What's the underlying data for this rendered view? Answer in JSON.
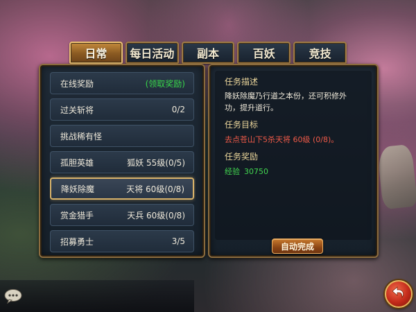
{
  "tabs": [
    {
      "label": "日常",
      "active": true
    },
    {
      "label": "每日活动",
      "active": false
    },
    {
      "label": "副本",
      "active": false
    },
    {
      "label": "百妖",
      "active": false
    },
    {
      "label": "竞技",
      "active": false
    }
  ],
  "tasks": [
    {
      "name": "在线奖励",
      "status": "(领取奖励)"
    },
    {
      "name": "过关斩将",
      "status": "0/2"
    },
    {
      "name": "挑战稀有怪",
      "status": ""
    },
    {
      "name": "孤胆英雄",
      "status": "狐妖 55级(0/5)"
    },
    {
      "name": "降妖除魔",
      "status": "天将 60级(0/8)"
    },
    {
      "name": "赏金猎手",
      "status": "天兵 60级(0/8)"
    },
    {
      "name": "招募勇士",
      "status": "3/5"
    }
  ],
  "selected_task": "降妖除魔",
  "detail": {
    "desc_title": "任务描述",
    "desc_text": "降妖除魔乃行道之本份，还可积修外功，提升道行。",
    "goal_title": "任务目标",
    "goal_text": "去点苍山下5杀天将 60级 (0/8)。",
    "reward_title": "任务奖励",
    "reward_label": "经验",
    "reward_value": "30750",
    "auto_button": "自动完成"
  },
  "colors": {
    "accent_gold": "#d9b36a",
    "claim_green": "#38d84a",
    "goal_red": "#ef5a48",
    "reward_green": "#42d850"
  },
  "icons": {
    "chat": "chat-bubble-icon",
    "back": "back-arrow-icon"
  }
}
